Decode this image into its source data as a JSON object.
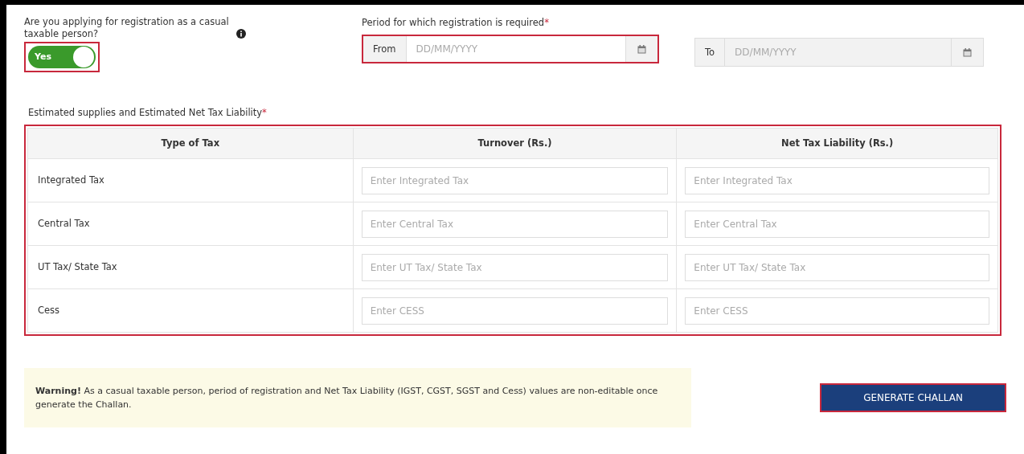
{
  "casual_question": {
    "label": "Are you applying for registration as a casual taxable person?",
    "toggle": {
      "label": "Yes",
      "on": true,
      "highlighted": true
    }
  },
  "period": {
    "label": "Period for which registration is required",
    "required_mark": "*",
    "from": {
      "addon": "From",
      "placeholder": "DD/MM/YYYY",
      "highlighted": true,
      "disabled": false
    },
    "to": {
      "addon": "To",
      "placeholder": "DD/MM/YYYY",
      "highlighted": false,
      "disabled": true
    }
  },
  "estimates": {
    "label": "Estimated supplies and Estimated Net Tax Liability",
    "required_mark": "*",
    "highlighted": true,
    "columns": [
      "Type of Tax",
      "Turnover (Rs.)",
      "Net Tax Liability (Rs.)"
    ],
    "rows": [
      {
        "type": "Integrated Tax",
        "turnover_placeholder": "Enter Integrated Tax",
        "liability_placeholder": "Enter Integrated Tax"
      },
      {
        "type": "Central Tax",
        "turnover_placeholder": "Enter Central Tax",
        "liability_placeholder": "Enter Central Tax"
      },
      {
        "type": "UT Tax/ State Tax",
        "turnover_placeholder": "Enter UT Tax/ State Tax",
        "liability_placeholder": "Enter UT Tax/ State Tax"
      },
      {
        "type": "Cess",
        "turnover_placeholder": "Enter CESS",
        "liability_placeholder": "Enter CESS"
      }
    ]
  },
  "warning": "**Warning!** As a casual taxable person, period of registration and Net Tax Liability (IGST, CGST, SGST and Cess) values are non-editable once generate the Challan.",
  "button": {
    "label": "GENERATE CHALLAN",
    "highlighted": true
  }
}
